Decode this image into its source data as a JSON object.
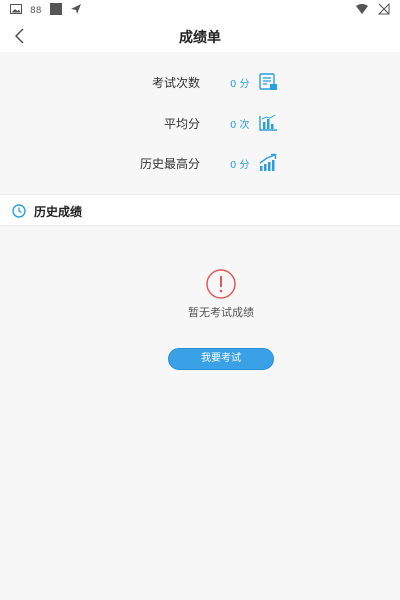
{
  "nav": {
    "title": "成绩单"
  },
  "stats": [
    {
      "label": "考试次数",
      "value": "0 分",
      "icon": "exam-sheet-icon"
    },
    {
      "label": "平均分",
      "value": "0 次",
      "icon": "bar-chart-icon"
    },
    {
      "label": "历史最高分",
      "value": "0 分",
      "icon": "trend-up-icon"
    }
  ],
  "history": {
    "title": "历史成绩",
    "empty_text": "暂无考试成绩",
    "button_label": "我要考试"
  },
  "colors": {
    "accent": "#2a9fe0",
    "warning": "#e05a5a",
    "button": "#3aa1e6"
  }
}
